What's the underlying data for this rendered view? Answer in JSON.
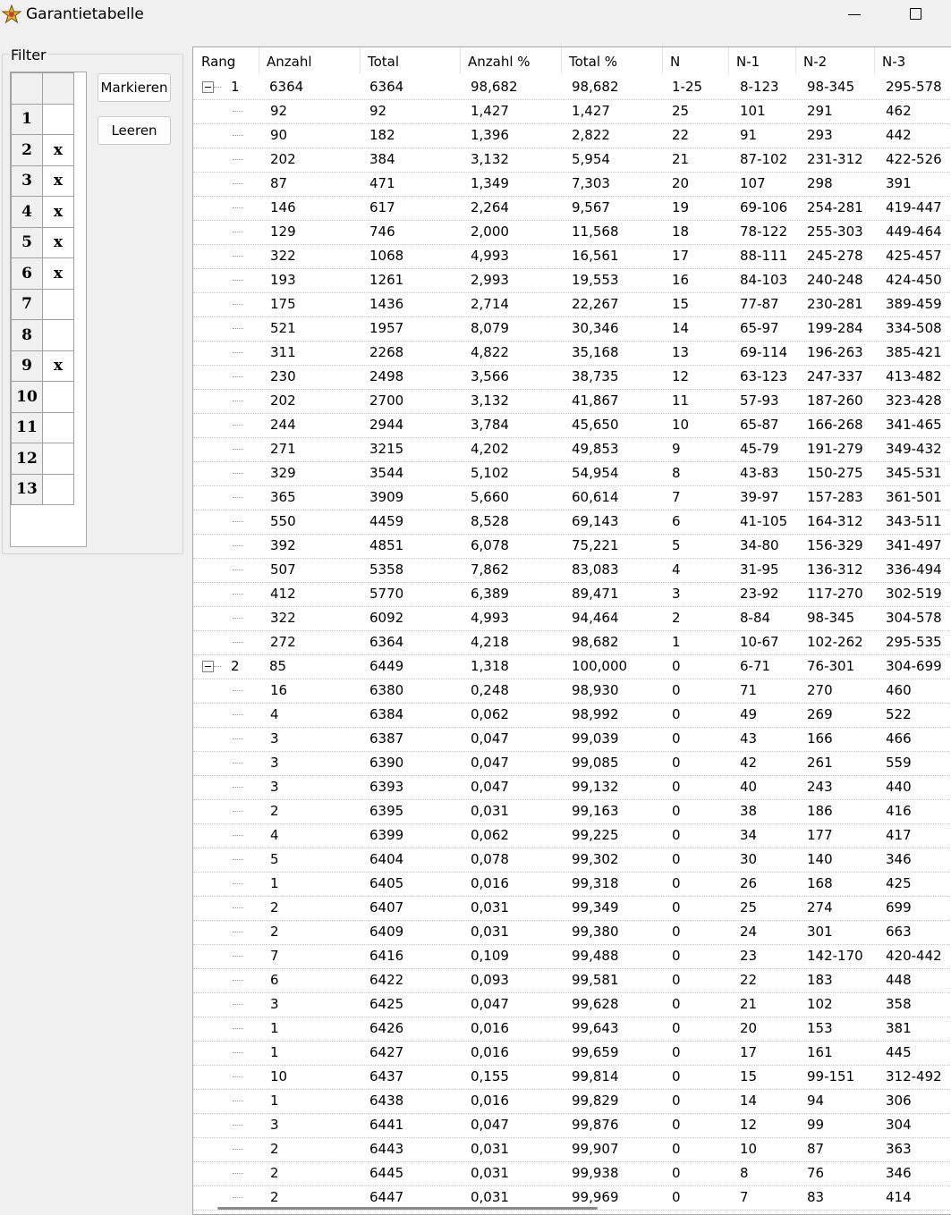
{
  "window": {
    "title": "Garantietabelle"
  },
  "filter": {
    "legend": "Filter",
    "rows": [
      {
        "label": "1",
        "mark": ""
      },
      {
        "label": "2",
        "mark": "x"
      },
      {
        "label": "3",
        "mark": "x"
      },
      {
        "label": "4",
        "mark": "x"
      },
      {
        "label": "5",
        "mark": "x"
      },
      {
        "label": "6",
        "mark": "x"
      },
      {
        "label": "7",
        "mark": ""
      },
      {
        "label": "8",
        "mark": ""
      },
      {
        "label": "9",
        "mark": "x"
      },
      {
        "label": "10",
        "mark": ""
      },
      {
        "label": "11",
        "mark": ""
      },
      {
        "label": "12",
        "mark": ""
      },
      {
        "label": "13",
        "mark": ""
      }
    ],
    "mark_label": "Markieren",
    "clear_label": "Leeren"
  },
  "table": {
    "columns": [
      "Rang",
      "Anzahl",
      "Total",
      "Anzahl %",
      "Total %",
      "N",
      "N-1",
      "N-2",
      "N-3"
    ],
    "rows": [
      {
        "group": true,
        "rang": "1",
        "c": [
          "6364",
          "6364",
          "98,682",
          "98,682",
          "1-25",
          "8-123",
          "98-345",
          "295-578"
        ]
      },
      {
        "c": [
          "92",
          "92",
          "1,427",
          "1,427",
          "25",
          "101",
          "291",
          "462"
        ]
      },
      {
        "c": [
          "90",
          "182",
          "1,396",
          "2,822",
          "22",
          "91",
          "293",
          "442"
        ]
      },
      {
        "c": [
          "202",
          "384",
          "3,132",
          "5,954",
          "21",
          "87-102",
          "231-312",
          "422-526"
        ]
      },
      {
        "c": [
          "87",
          "471",
          "1,349",
          "7,303",
          "20",
          "107",
          "298",
          "391"
        ]
      },
      {
        "c": [
          "146",
          "617",
          "2,264",
          "9,567",
          "19",
          "69-106",
          "254-281",
          "419-447"
        ]
      },
      {
        "c": [
          "129",
          "746",
          "2,000",
          "11,568",
          "18",
          "78-122",
          "255-303",
          "449-464"
        ]
      },
      {
        "c": [
          "322",
          "1068",
          "4,993",
          "16,561",
          "17",
          "88-111",
          "245-278",
          "425-457"
        ]
      },
      {
        "c": [
          "193",
          "1261",
          "2,993",
          "19,553",
          "16",
          "84-103",
          "240-248",
          "424-450"
        ]
      },
      {
        "c": [
          "175",
          "1436",
          "2,714",
          "22,267",
          "15",
          "77-87",
          "230-281",
          "389-459"
        ]
      },
      {
        "c": [
          "521",
          "1957",
          "8,079",
          "30,346",
          "14",
          "65-97",
          "199-284",
          "334-508"
        ]
      },
      {
        "c": [
          "311",
          "2268",
          "4,822",
          "35,168",
          "13",
          "69-114",
          "196-263",
          "385-421"
        ]
      },
      {
        "c": [
          "230",
          "2498",
          "3,566",
          "38,735",
          "12",
          "63-123",
          "247-337",
          "413-482"
        ]
      },
      {
        "c": [
          "202",
          "2700",
          "3,132",
          "41,867",
          "11",
          "57-93",
          "187-260",
          "323-428"
        ]
      },
      {
        "c": [
          "244",
          "2944",
          "3,784",
          "45,650",
          "10",
          "65-87",
          "166-268",
          "341-465"
        ]
      },
      {
        "c": [
          "271",
          "3215",
          "4,202",
          "49,853",
          "9",
          "45-79",
          "191-279",
          "349-432"
        ]
      },
      {
        "c": [
          "329",
          "3544",
          "5,102",
          "54,954",
          "8",
          "43-83",
          "150-275",
          "345-531"
        ]
      },
      {
        "c": [
          "365",
          "3909",
          "5,660",
          "60,614",
          "7",
          "39-97",
          "157-283",
          "361-501"
        ]
      },
      {
        "c": [
          "550",
          "4459",
          "8,528",
          "69,143",
          "6",
          "41-105",
          "164-312",
          "343-511"
        ]
      },
      {
        "c": [
          "392",
          "4851",
          "6,078",
          "75,221",
          "5",
          "34-80",
          "156-329",
          "341-497"
        ]
      },
      {
        "c": [
          "507",
          "5358",
          "7,862",
          "83,083",
          "4",
          "31-95",
          "136-312",
          "336-494"
        ]
      },
      {
        "c": [
          "412",
          "5770",
          "6,389",
          "89,471",
          "3",
          "23-92",
          "117-270",
          "302-519"
        ]
      },
      {
        "c": [
          "322",
          "6092",
          "4,993",
          "94,464",
          "2",
          "8-84",
          "98-345",
          "304-578"
        ]
      },
      {
        "c": [
          "272",
          "6364",
          "4,218",
          "98,682",
          "1",
          "10-67",
          "102-262",
          "295-535"
        ],
        "last": true
      },
      {
        "group": true,
        "rang": "2",
        "c": [
          "85",
          "6449",
          "1,318",
          "100,000",
          "0",
          "6-71",
          "76-301",
          "304-699"
        ]
      },
      {
        "c": [
          "16",
          "6380",
          "0,248",
          "98,930",
          "0",
          "71",
          "270",
          "460"
        ]
      },
      {
        "c": [
          "4",
          "6384",
          "0,062",
          "98,992",
          "0",
          "49",
          "269",
          "522"
        ]
      },
      {
        "c": [
          "3",
          "6387",
          "0,047",
          "99,039",
          "0",
          "43",
          "166",
          "466"
        ]
      },
      {
        "c": [
          "3",
          "6390",
          "0,047",
          "99,085",
          "0",
          "42",
          "261",
          "559"
        ]
      },
      {
        "c": [
          "3",
          "6393",
          "0,047",
          "99,132",
          "0",
          "40",
          "243",
          "440"
        ]
      },
      {
        "c": [
          "2",
          "6395",
          "0,031",
          "99,163",
          "0",
          "38",
          "186",
          "416"
        ]
      },
      {
        "c": [
          "4",
          "6399",
          "0,062",
          "99,225",
          "0",
          "34",
          "177",
          "417"
        ]
      },
      {
        "c": [
          "5",
          "6404",
          "0,078",
          "99,302",
          "0",
          "30",
          "140",
          "346"
        ]
      },
      {
        "c": [
          "1",
          "6405",
          "0,016",
          "99,318",
          "0",
          "26",
          "168",
          "425"
        ]
      },
      {
        "c": [
          "2",
          "6407",
          "0,031",
          "99,349",
          "0",
          "25",
          "274",
          "699"
        ]
      },
      {
        "c": [
          "2",
          "6409",
          "0,031",
          "99,380",
          "0",
          "24",
          "301",
          "663"
        ]
      },
      {
        "c": [
          "7",
          "6416",
          "0,109",
          "99,488",
          "0",
          "23",
          "142-170",
          "420-442"
        ]
      },
      {
        "c": [
          "6",
          "6422",
          "0,093",
          "99,581",
          "0",
          "22",
          "183",
          "448"
        ]
      },
      {
        "c": [
          "3",
          "6425",
          "0,047",
          "99,628",
          "0",
          "21",
          "102",
          "358"
        ]
      },
      {
        "c": [
          "1",
          "6426",
          "0,016",
          "99,643",
          "0",
          "20",
          "153",
          "381"
        ]
      },
      {
        "c": [
          "1",
          "6427",
          "0,016",
          "99,659",
          "0",
          "17",
          "161",
          "445"
        ]
      },
      {
        "c": [
          "10",
          "6437",
          "0,155",
          "99,814",
          "0",
          "15",
          "99-151",
          "312-492"
        ]
      },
      {
        "c": [
          "1",
          "6438",
          "0,016",
          "99,829",
          "0",
          "14",
          "94",
          "306"
        ]
      },
      {
        "c": [
          "3",
          "6441",
          "0,047",
          "99,876",
          "0",
          "12",
          "99",
          "304"
        ]
      },
      {
        "c": [
          "2",
          "6443",
          "0,031",
          "99,907",
          "0",
          "10",
          "87",
          "363"
        ]
      },
      {
        "c": [
          "2",
          "6445",
          "0,031",
          "99,938",
          "0",
          "8",
          "76",
          "346"
        ]
      },
      {
        "c": [
          "2",
          "6447",
          "0,031",
          "99,969",
          "0",
          "7",
          "83",
          "414"
        ]
      }
    ]
  }
}
